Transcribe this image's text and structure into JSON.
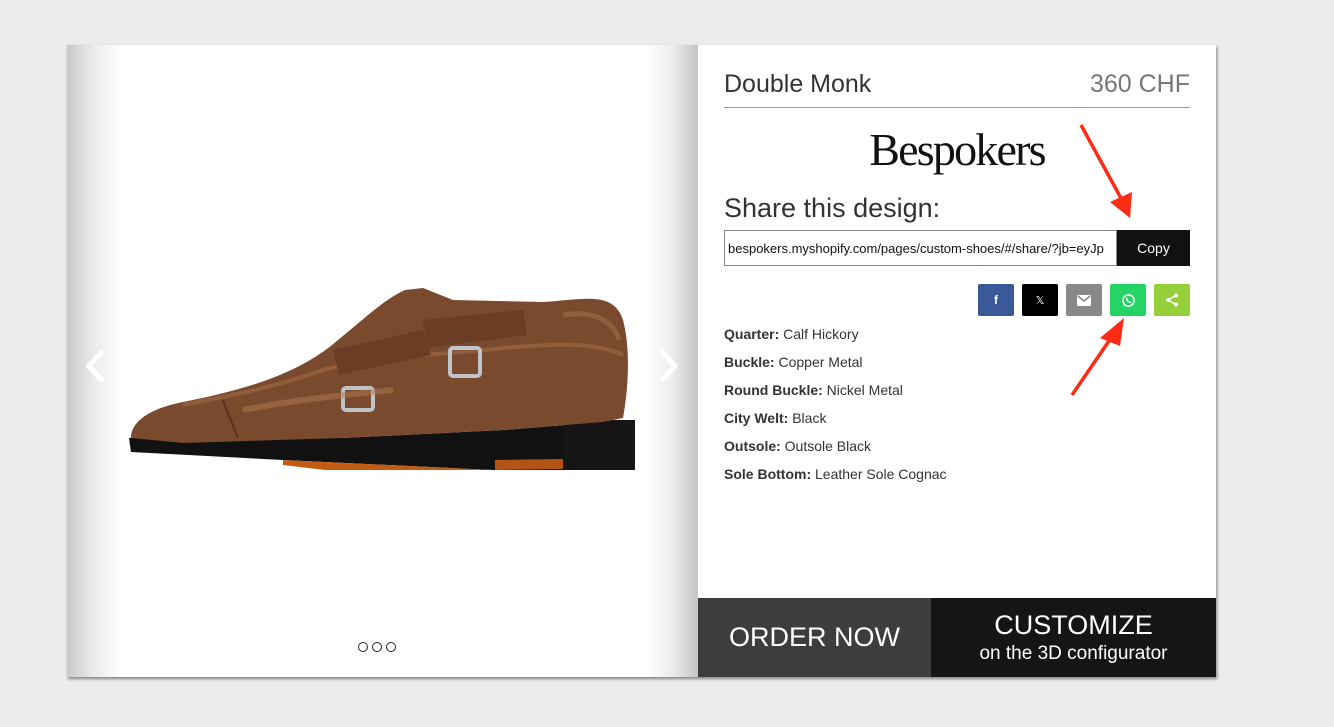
{
  "product": {
    "name": "Double Monk",
    "price": "360 CHF"
  },
  "brand": {
    "logo_text": "Bespokers"
  },
  "share": {
    "heading": "Share this design:",
    "url": "bespokers.myshopify.com/pages/custom-shoes/#/share/?jb=eyJp",
    "copy_label": "Copy",
    "social_buttons": [
      {
        "icon": "facebook-icon",
        "color": "#3b5998"
      },
      {
        "icon": "x-icon",
        "color": "#000000"
      },
      {
        "icon": "email-icon",
        "color": "#888888"
      },
      {
        "icon": "whatsapp-icon",
        "color": "#25d366"
      },
      {
        "icon": "share-icon",
        "color": "#95d03a"
      }
    ]
  },
  "specs": [
    {
      "label": "Quarter:",
      "value": "Calf Hickory"
    },
    {
      "label": "Buckle:",
      "value": "Copper Metal"
    },
    {
      "label": "Round Buckle:",
      "value": "Nickel Metal"
    },
    {
      "label": "City Welt:",
      "value": "Black"
    },
    {
      "label": "Outsole:",
      "value": "Outsole Black"
    },
    {
      "label": "Sole Bottom:",
      "value": "Leather Sole Cognac"
    }
  ],
  "actions": {
    "order_label": "ORDER NOW",
    "customize_label": "CUSTOMIZE",
    "customize_sub": "on the 3D configurator"
  },
  "gallery": {
    "dot_count": 3
  },
  "colors": {
    "annotation_arrow": "#ff2a14",
    "shoe_leather": "#7a4a2e",
    "sole": "#111111"
  }
}
